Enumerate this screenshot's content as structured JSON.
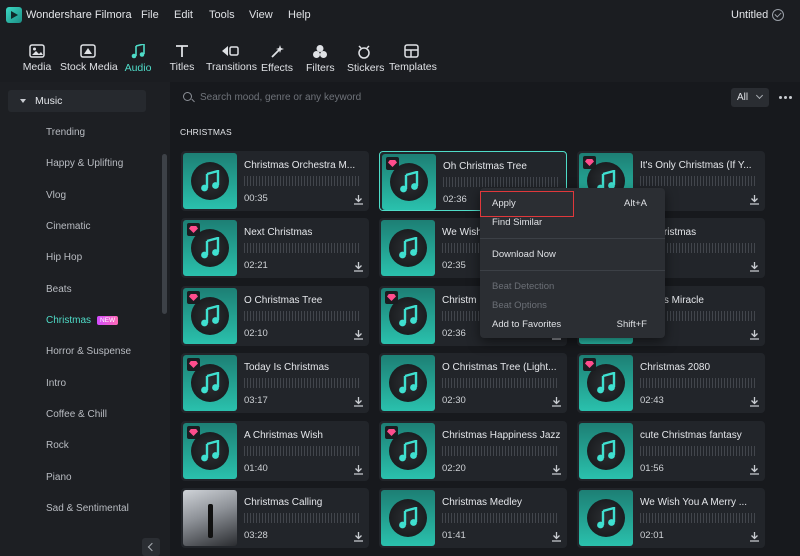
{
  "app": {
    "name": "Wondershare Filmora",
    "document_title": "Untitled"
  },
  "menu": [
    "File",
    "Edit",
    "Tools",
    "View",
    "Help"
  ],
  "toolbar": [
    {
      "label": "Media",
      "icon": "media-icon"
    },
    {
      "label": "Stock Media",
      "icon": "stock-media-icon"
    },
    {
      "label": "Audio",
      "icon": "audio-icon",
      "active": true
    },
    {
      "label": "Titles",
      "icon": "titles-icon"
    },
    {
      "label": "Transitions",
      "icon": "transitions-icon"
    },
    {
      "label": "Effects",
      "icon": "effects-icon"
    },
    {
      "label": "Filters",
      "icon": "filters-icon"
    },
    {
      "label": "Stickers",
      "icon": "stickers-icon"
    },
    {
      "label": "Templates",
      "icon": "templates-icon"
    }
  ],
  "sidebar": {
    "header": "Music",
    "items": [
      "Trending",
      "Happy & Uplifting",
      "Vlog",
      "Cinematic",
      "Hip Hop",
      "Beats",
      "Christmas",
      "Horror & Suspense",
      "Intro",
      "Coffee & Chill",
      "Rock",
      "Piano",
      "Sad & Sentimental"
    ],
    "active": "Christmas",
    "new_badge": "NEW"
  },
  "search": {
    "placeholder": "Search mood, genre or any keyword"
  },
  "filter": {
    "value": "All"
  },
  "section_title": "CHRISTMAS",
  "tracks": [
    {
      "title": "Christmas Orchestra M...",
      "duration": "00:35",
      "premium": false
    },
    {
      "title": "Oh Christmas Tree",
      "duration": "02:36",
      "premium": true
    },
    {
      "title": "It's Only Christmas (If Y...",
      "duration": "",
      "premium": true
    },
    {
      "title": "Next Christmas",
      "duration": "02:21",
      "premium": true
    },
    {
      "title": "We Wish",
      "duration": "02:35",
      "premium": false
    },
    {
      "title": "ry Christmas",
      "duration": "",
      "premium": false
    },
    {
      "title": "O Christmas Tree",
      "duration": "02:10",
      "premium": true
    },
    {
      "title": "Christm",
      "duration": "02:36",
      "premium": true
    },
    {
      "title": "istmas Miracle",
      "duration": "",
      "premium": false
    },
    {
      "title": "Today Is Christmas",
      "duration": "03:17",
      "premium": true
    },
    {
      "title": "O Christmas Tree (Light...",
      "duration": "02:30",
      "premium": false
    },
    {
      "title": "Christmas 2080",
      "duration": "02:43",
      "premium": true
    },
    {
      "title": "A Christmas Wish",
      "duration": "01:40",
      "premium": true
    },
    {
      "title": "Christmas Happiness Jazz",
      "duration": "02:20",
      "premium": true
    },
    {
      "title": "cute Christmas fantasy",
      "duration": "01:56",
      "premium": false
    },
    {
      "title": "Christmas Calling",
      "duration": "03:28",
      "premium": false
    },
    {
      "title": "Christmas Medley",
      "duration": "01:41",
      "premium": false
    },
    {
      "title": "We Wish You A Merry ...",
      "duration": "02:01",
      "premium": false
    }
  ],
  "context_menu": {
    "items": [
      {
        "label": "Apply",
        "shortcut": "Alt+A",
        "enabled": true
      },
      {
        "label": "Find Similar",
        "shortcut": "",
        "enabled": true
      },
      {
        "label": "Download Now",
        "shortcut": "",
        "enabled": true
      },
      {
        "label": "Beat Detection",
        "shortcut": "",
        "enabled": false
      },
      {
        "label": "Beat Options",
        "shortcut": "",
        "enabled": false
      },
      {
        "label": "Add to Favorites",
        "shortcut": "Shift+F",
        "enabled": true
      }
    ]
  },
  "colors": {
    "accent": "#4fdcc8",
    "highlight": "#e0383b",
    "background": "#17191d"
  }
}
